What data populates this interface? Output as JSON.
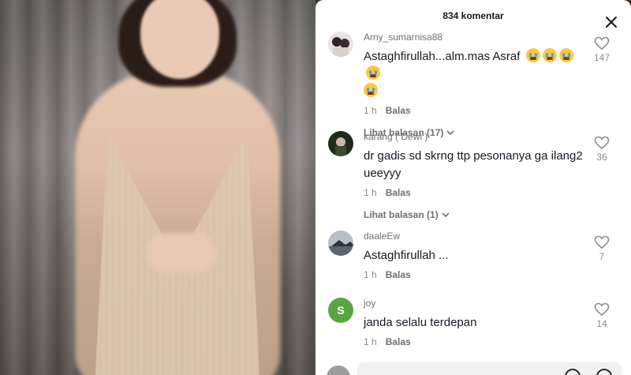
{
  "header": {
    "title": "834 komentar"
  },
  "comments": [
    {
      "username": "Arny_sumarnisa88",
      "text": "Astaghfirullah...alm.mas Asraf",
      "emoji_count": 5,
      "time": "1 h",
      "reply_label": "Balas",
      "likes": "147",
      "view_replies": "Lihat balasan (17)"
    },
    {
      "username": "karang ( Dewi )",
      "text": "dr gadis sd skrng ttp pesonanya ga ilang2 ueeyyy",
      "time": "1 h",
      "reply_label": "Balas",
      "likes": "36",
      "view_replies": "Lihat balasan (1)"
    },
    {
      "username": "daaleEw",
      "text": "Astaghfirullah ...",
      "time": "1 h",
      "reply_label": "Balas",
      "likes": "7"
    },
    {
      "username": "joy",
      "avatar_letter": "S",
      "text": "janda selalu terdepan",
      "time": "1 h",
      "reply_label": "Balas",
      "likes": "14"
    }
  ],
  "colors": {
    "avatar_s": "#5aa543",
    "text": "#161823",
    "muted": "#8a8b91"
  }
}
